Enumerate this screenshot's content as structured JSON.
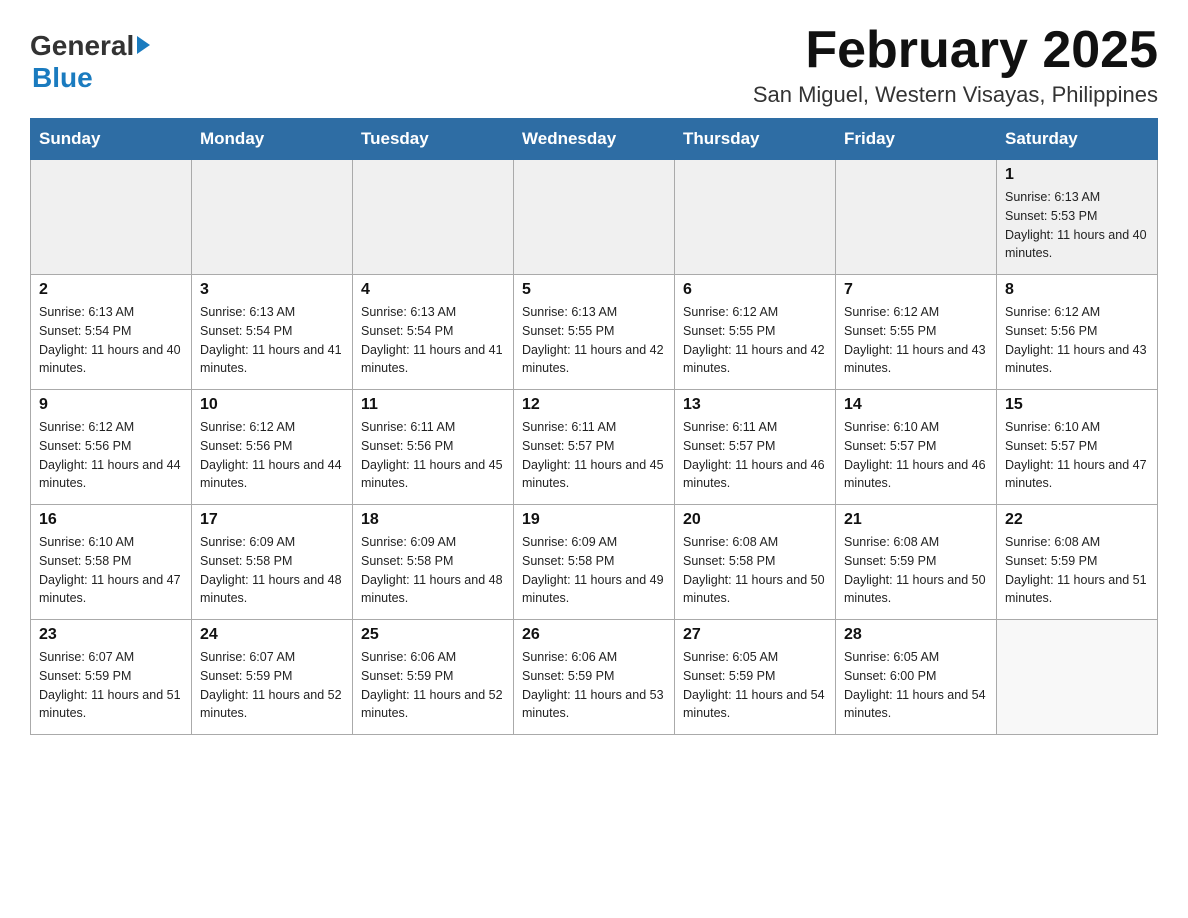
{
  "header": {
    "logo_general": "General",
    "logo_blue": "Blue",
    "month_title": "February 2025",
    "location": "San Miguel, Western Visayas, Philippines"
  },
  "days_of_week": [
    "Sunday",
    "Monday",
    "Tuesday",
    "Wednesday",
    "Thursday",
    "Friday",
    "Saturday"
  ],
  "weeks": [
    [
      {
        "day": "",
        "sunrise": "",
        "sunset": "",
        "daylight": ""
      },
      {
        "day": "",
        "sunrise": "",
        "sunset": "",
        "daylight": ""
      },
      {
        "day": "",
        "sunrise": "",
        "sunset": "",
        "daylight": ""
      },
      {
        "day": "",
        "sunrise": "",
        "sunset": "",
        "daylight": ""
      },
      {
        "day": "",
        "sunrise": "",
        "sunset": "",
        "daylight": ""
      },
      {
        "day": "",
        "sunrise": "",
        "sunset": "",
        "daylight": ""
      },
      {
        "day": "1",
        "sunrise": "Sunrise: 6:13 AM",
        "sunset": "Sunset: 5:53 PM",
        "daylight": "Daylight: 11 hours and 40 minutes."
      }
    ],
    [
      {
        "day": "2",
        "sunrise": "Sunrise: 6:13 AM",
        "sunset": "Sunset: 5:54 PM",
        "daylight": "Daylight: 11 hours and 40 minutes."
      },
      {
        "day": "3",
        "sunrise": "Sunrise: 6:13 AM",
        "sunset": "Sunset: 5:54 PM",
        "daylight": "Daylight: 11 hours and 41 minutes."
      },
      {
        "day": "4",
        "sunrise": "Sunrise: 6:13 AM",
        "sunset": "Sunset: 5:54 PM",
        "daylight": "Daylight: 11 hours and 41 minutes."
      },
      {
        "day": "5",
        "sunrise": "Sunrise: 6:13 AM",
        "sunset": "Sunset: 5:55 PM",
        "daylight": "Daylight: 11 hours and 42 minutes."
      },
      {
        "day": "6",
        "sunrise": "Sunrise: 6:12 AM",
        "sunset": "Sunset: 5:55 PM",
        "daylight": "Daylight: 11 hours and 42 minutes."
      },
      {
        "day": "7",
        "sunrise": "Sunrise: 6:12 AM",
        "sunset": "Sunset: 5:55 PM",
        "daylight": "Daylight: 11 hours and 43 minutes."
      },
      {
        "day": "8",
        "sunrise": "Sunrise: 6:12 AM",
        "sunset": "Sunset: 5:56 PM",
        "daylight": "Daylight: 11 hours and 43 minutes."
      }
    ],
    [
      {
        "day": "9",
        "sunrise": "Sunrise: 6:12 AM",
        "sunset": "Sunset: 5:56 PM",
        "daylight": "Daylight: 11 hours and 44 minutes."
      },
      {
        "day": "10",
        "sunrise": "Sunrise: 6:12 AM",
        "sunset": "Sunset: 5:56 PM",
        "daylight": "Daylight: 11 hours and 44 minutes."
      },
      {
        "day": "11",
        "sunrise": "Sunrise: 6:11 AM",
        "sunset": "Sunset: 5:56 PM",
        "daylight": "Daylight: 11 hours and 45 minutes."
      },
      {
        "day": "12",
        "sunrise": "Sunrise: 6:11 AM",
        "sunset": "Sunset: 5:57 PM",
        "daylight": "Daylight: 11 hours and 45 minutes."
      },
      {
        "day": "13",
        "sunrise": "Sunrise: 6:11 AM",
        "sunset": "Sunset: 5:57 PM",
        "daylight": "Daylight: 11 hours and 46 minutes."
      },
      {
        "day": "14",
        "sunrise": "Sunrise: 6:10 AM",
        "sunset": "Sunset: 5:57 PM",
        "daylight": "Daylight: 11 hours and 46 minutes."
      },
      {
        "day": "15",
        "sunrise": "Sunrise: 6:10 AM",
        "sunset": "Sunset: 5:57 PM",
        "daylight": "Daylight: 11 hours and 47 minutes."
      }
    ],
    [
      {
        "day": "16",
        "sunrise": "Sunrise: 6:10 AM",
        "sunset": "Sunset: 5:58 PM",
        "daylight": "Daylight: 11 hours and 47 minutes."
      },
      {
        "day": "17",
        "sunrise": "Sunrise: 6:09 AM",
        "sunset": "Sunset: 5:58 PM",
        "daylight": "Daylight: 11 hours and 48 minutes."
      },
      {
        "day": "18",
        "sunrise": "Sunrise: 6:09 AM",
        "sunset": "Sunset: 5:58 PM",
        "daylight": "Daylight: 11 hours and 48 minutes."
      },
      {
        "day": "19",
        "sunrise": "Sunrise: 6:09 AM",
        "sunset": "Sunset: 5:58 PM",
        "daylight": "Daylight: 11 hours and 49 minutes."
      },
      {
        "day": "20",
        "sunrise": "Sunrise: 6:08 AM",
        "sunset": "Sunset: 5:58 PM",
        "daylight": "Daylight: 11 hours and 50 minutes."
      },
      {
        "day": "21",
        "sunrise": "Sunrise: 6:08 AM",
        "sunset": "Sunset: 5:59 PM",
        "daylight": "Daylight: 11 hours and 50 minutes."
      },
      {
        "day": "22",
        "sunrise": "Sunrise: 6:08 AM",
        "sunset": "Sunset: 5:59 PM",
        "daylight": "Daylight: 11 hours and 51 minutes."
      }
    ],
    [
      {
        "day": "23",
        "sunrise": "Sunrise: 6:07 AM",
        "sunset": "Sunset: 5:59 PM",
        "daylight": "Daylight: 11 hours and 51 minutes."
      },
      {
        "day": "24",
        "sunrise": "Sunrise: 6:07 AM",
        "sunset": "Sunset: 5:59 PM",
        "daylight": "Daylight: 11 hours and 52 minutes."
      },
      {
        "day": "25",
        "sunrise": "Sunrise: 6:06 AM",
        "sunset": "Sunset: 5:59 PM",
        "daylight": "Daylight: 11 hours and 52 minutes."
      },
      {
        "day": "26",
        "sunrise": "Sunrise: 6:06 AM",
        "sunset": "Sunset: 5:59 PM",
        "daylight": "Daylight: 11 hours and 53 minutes."
      },
      {
        "day": "27",
        "sunrise": "Sunrise: 6:05 AM",
        "sunset": "Sunset: 5:59 PM",
        "daylight": "Daylight: 11 hours and 54 minutes."
      },
      {
        "day": "28",
        "sunrise": "Sunrise: 6:05 AM",
        "sunset": "Sunset: 6:00 PM",
        "daylight": "Daylight: 11 hours and 54 minutes."
      },
      {
        "day": "",
        "sunrise": "",
        "sunset": "",
        "daylight": ""
      }
    ]
  ]
}
